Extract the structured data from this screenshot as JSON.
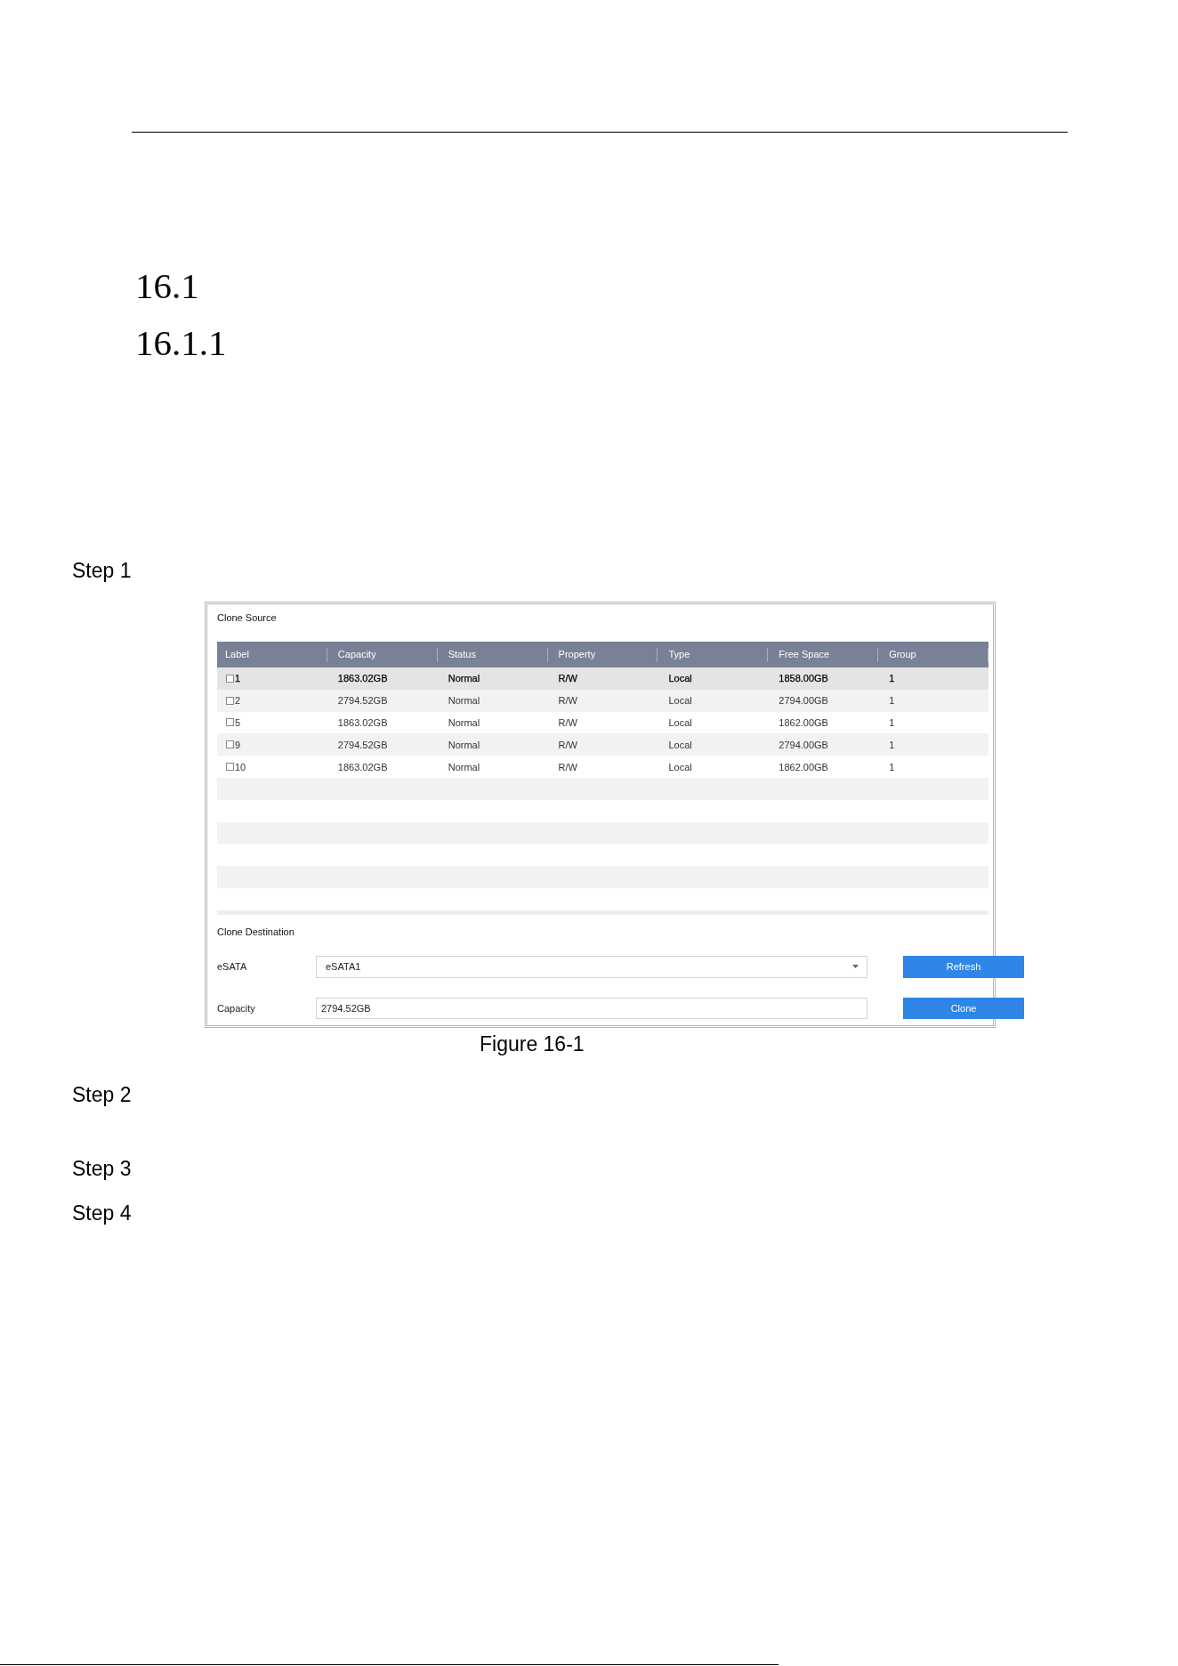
{
  "section": {
    "number": "16.1"
  },
  "subsection": {
    "number": "16.1.1"
  },
  "steps": [
    {
      "label": "Step 1",
      "figure": {
        "clone_source": {
          "title": "Clone Source",
          "table": {
            "columns": [
              "Label",
              "Capacity",
              "Status",
              "Property",
              "Type",
              "Free Space",
              "Group"
            ],
            "rows": [
              {
                "selected": true,
                "checked": false,
                "cells": [
                  "1",
                  "1863.02GB",
                  "Normal",
                  "R/W",
                  "Local",
                  "1858.00GB",
                  "1"
                ]
              },
              {
                "selected": false,
                "checked": false,
                "cells": [
                  "2",
                  "2794.52GB",
                  "Normal",
                  "R/W",
                  "Local",
                  "2794.00GB",
                  "1"
                ]
              },
              {
                "selected": false,
                "checked": false,
                "cells": [
                  "5",
                  "1863.02GB",
                  "Normal",
                  "R/W",
                  "Local",
                  "1862.00GB",
                  "1"
                ]
              },
              {
                "selected": false,
                "checked": false,
                "cells": [
                  "9",
                  "2794.52GB",
                  "Normal",
                  "R/W",
                  "Local",
                  "2794.00GB",
                  "1"
                ]
              },
              {
                "selected": false,
                "checked": false,
                "cells": [
                  "10",
                  "1863.02GB",
                  "Normal",
                  "R/W",
                  "Local",
                  "1862.00GB",
                  "1"
                ]
              }
            ]
          }
        },
        "clone_destination": {
          "title": "Clone Destination",
          "fields": [
            {
              "kind": "dropdown",
              "label": "eSATA",
              "value": "eSATA1",
              "button": "Refresh"
            },
            {
              "kind": "text",
              "label": "Capacity",
              "value": "2794.52GB",
              "button": "Clone"
            }
          ]
        },
        "caption": "Figure 16-1"
      }
    },
    {
      "label": "Step 2"
    },
    {
      "label": "Step 3"
    },
    {
      "label": "Step 4"
    }
  ]
}
